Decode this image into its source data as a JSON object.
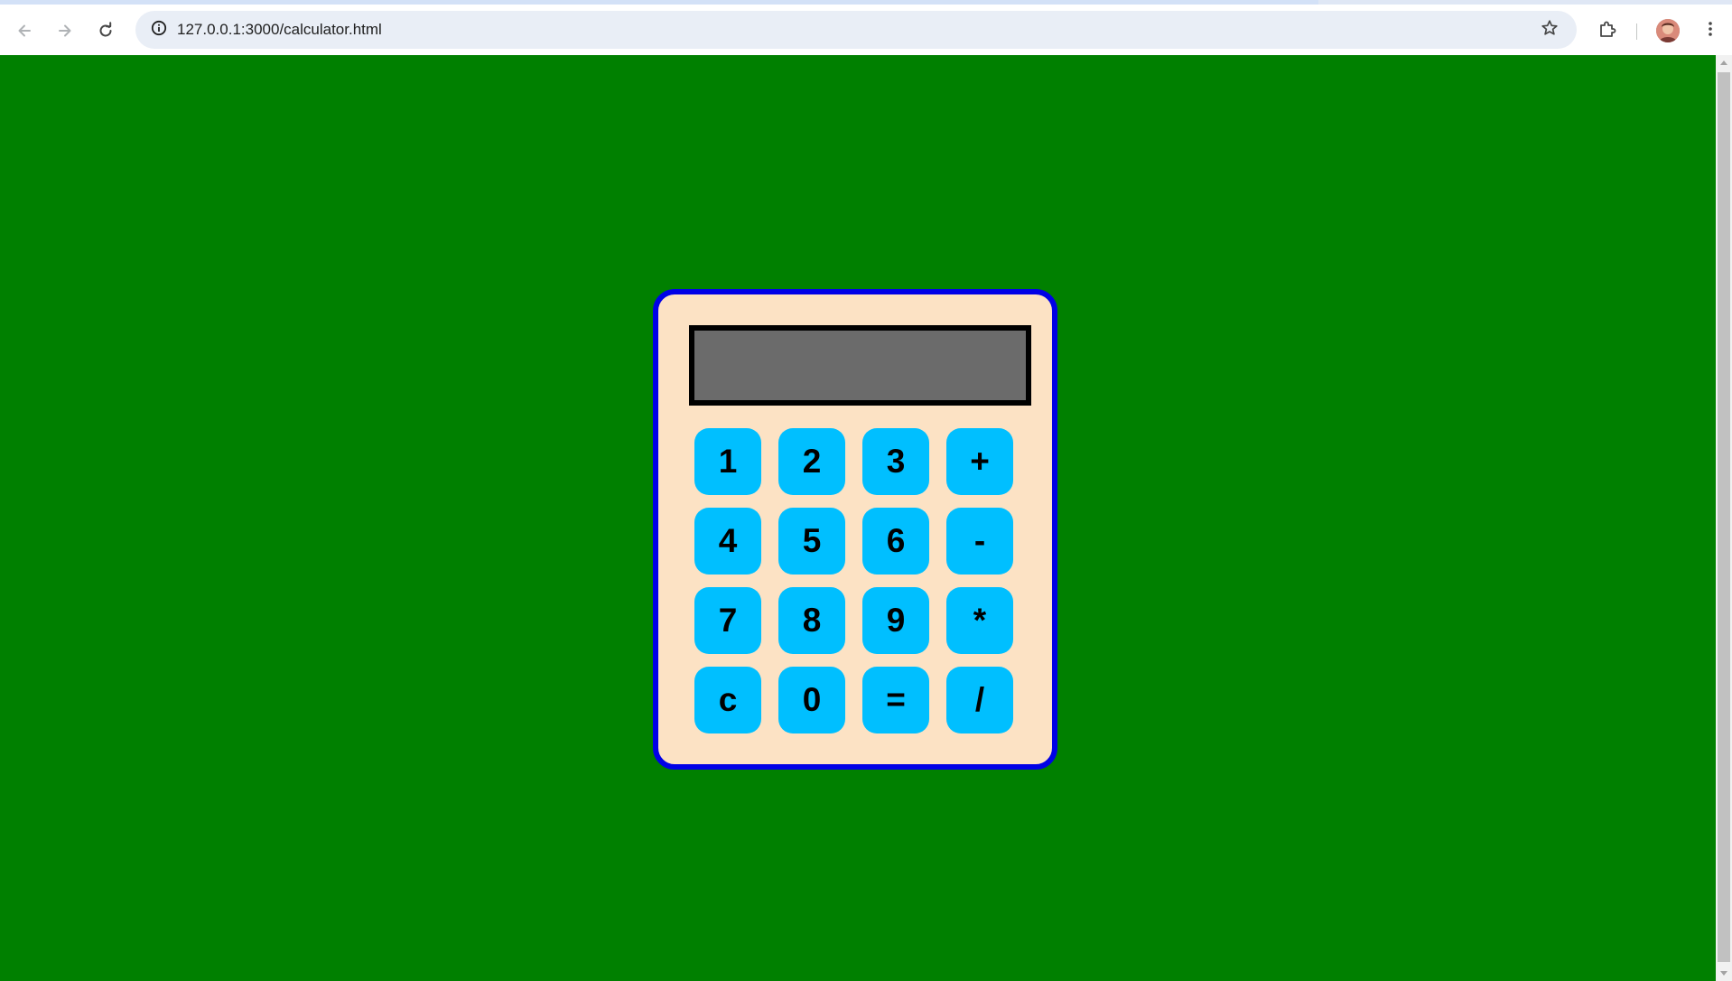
{
  "browser": {
    "url": "127.0.0.1:3000/calculator.html",
    "icons": {
      "back": "back-arrow-icon",
      "forward": "forward-arrow-icon",
      "reload": "reload-icon",
      "site_info": "info-icon",
      "bookmark": "star-icon",
      "extensions": "puzzle-icon",
      "menu": "more-vert-icon"
    }
  },
  "page": {
    "background_color": "#008000"
  },
  "calculator": {
    "display_value": "",
    "colors": {
      "body": "#fce2c4",
      "border": "#0000e6",
      "display": "#6b6b6b",
      "key": "#00bfff"
    },
    "keys": [
      {
        "label": "1",
        "name": "key-1-button"
      },
      {
        "label": "2",
        "name": "key-2-button"
      },
      {
        "label": "3",
        "name": "key-3-button"
      },
      {
        "label": "+",
        "name": "key-plus-button"
      },
      {
        "label": "4",
        "name": "key-4-button"
      },
      {
        "label": "5",
        "name": "key-5-button"
      },
      {
        "label": "6",
        "name": "key-6-button"
      },
      {
        "label": "-",
        "name": "key-minus-button"
      },
      {
        "label": "7",
        "name": "key-7-button"
      },
      {
        "label": "8",
        "name": "key-8-button"
      },
      {
        "label": "9",
        "name": "key-9-button"
      },
      {
        "label": "*",
        "name": "key-multiply-button"
      },
      {
        "label": "c",
        "name": "key-clear-button"
      },
      {
        "label": "0",
        "name": "key-0-button"
      },
      {
        "label": "=",
        "name": "key-equals-button"
      },
      {
        "label": "/",
        "name": "key-divide-button"
      }
    ]
  }
}
